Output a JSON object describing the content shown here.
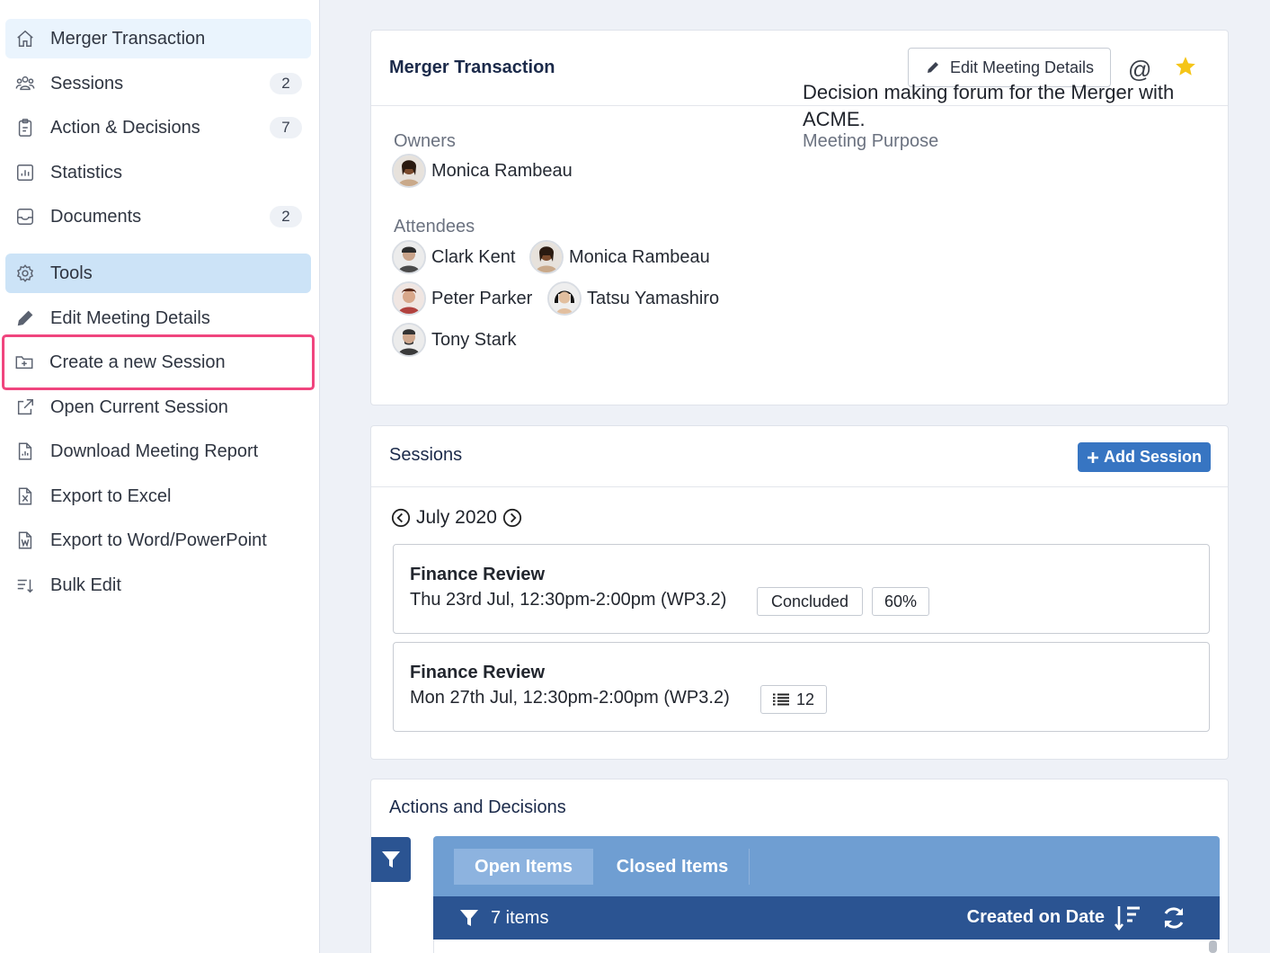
{
  "sidebar": {
    "items": [
      {
        "label": "Merger Transaction",
        "icon": "home-icon"
      },
      {
        "label": "Sessions",
        "icon": "people-icon",
        "badge": "2"
      },
      {
        "label": "Action & Decisions",
        "icon": "clipboard-icon",
        "badge": "7"
      },
      {
        "label": "Statistics",
        "icon": "chart-icon"
      },
      {
        "label": "Documents",
        "icon": "inbox-icon",
        "badge": "2"
      }
    ],
    "tools_label": "Tools",
    "tools": [
      {
        "label": "Edit Meeting Details",
        "icon": "pencil-icon"
      },
      {
        "label": "Create a new Session",
        "icon": "folder-plus-icon"
      },
      {
        "label": "Open Current Session",
        "icon": "external-link-icon"
      },
      {
        "label": "Download Meeting Report",
        "icon": "report-icon"
      },
      {
        "label": "Export to Excel",
        "icon": "excel-icon"
      },
      {
        "label": "Export to Word/PowerPoint",
        "icon": "word-icon"
      },
      {
        "label": "Bulk Edit",
        "icon": "bulk-edit-icon"
      }
    ]
  },
  "meeting": {
    "title": "Merger Transaction",
    "edit_button": "Edit Meeting Details",
    "at_symbol": "@",
    "owners_label": "Owners",
    "owners": [
      "Monica Rambeau"
    ],
    "attendees_label": "Attendees",
    "attendees": [
      "Clark Kent",
      "Monica Rambeau",
      "Peter Parker",
      "Tatsu Yamashiro",
      "Tony Stark"
    ],
    "purpose_label": "Meeting Purpose",
    "purpose": "Decision making forum for the Merger with ACME."
  },
  "sessions": {
    "title": "Sessions",
    "add_button": "Add Session",
    "month": "July 2020",
    "list": [
      {
        "title": "Finance Review",
        "time": "Thu 23rd Jul, 12:30pm-2:00pm (WP3.2)",
        "status": "Concluded",
        "progress": "60%"
      },
      {
        "title": "Finance Review",
        "time": "Mon 27th Jul, 12:30pm-2:00pm (WP3.2)",
        "count": "12"
      }
    ]
  },
  "actions": {
    "title": "Actions and Decisions",
    "tabs": [
      "Open Items",
      "Closed Items"
    ],
    "items_count": "7 items",
    "sort_label": "Created on Date"
  },
  "colors": {
    "accent": "#3775c2",
    "nav_dark": "#2b5492",
    "tabs_bg": "#6f9ed2",
    "highlight": "#f0457e",
    "star": "#f5c518"
  }
}
